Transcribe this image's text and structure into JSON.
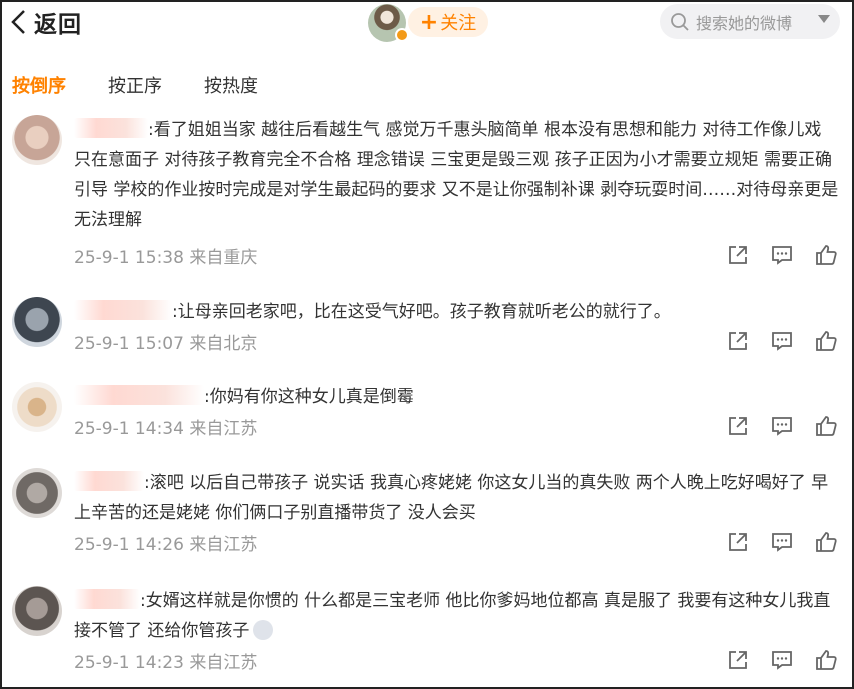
{
  "header": {
    "back_label": "返回",
    "follow_label": "关注",
    "search_placeholder": "搜索她的微博"
  },
  "tabs": [
    {
      "label": "按倒序",
      "active": true
    },
    {
      "label": "按正序",
      "active": false
    },
    {
      "label": "按热度",
      "active": false
    }
  ],
  "comments": [
    {
      "text": ":看了姐姐当家 越往后看越生气 感觉万千惠头脑简单 根本没有思想和能力 对待工作像儿戏 只在意面子  对待孩子教育完全不合格 理念错误 三宝更是毁三观 孩子正因为小才需要立规矩 需要正确引导  学校的作业按时完成是对学生最起码的要求 又不是让你强制补课 剥夺玩耍时间……对待母亲更是 无法理解",
      "time": "25-9-1 15:38",
      "location": "来自重庆"
    },
    {
      "text": ":让母亲回老家吧，比在这受气好吧。孩子教育就听老公的就行了。",
      "time": "25-9-1 15:07",
      "location": "来自北京"
    },
    {
      "text": ":你妈有你这种女儿真是倒霉",
      "time": "25-9-1 14:34",
      "location": "来自江苏"
    },
    {
      "text": ":滚吧 以后自己带孩子 说实话 我真心疼姥姥 你这女儿当的真失败 两个人晚上吃好喝好了 早上辛苦的还是姥姥 你们俩口子别直播带货了 没人会买",
      "time": "25-9-1 14:26",
      "location": "来自江苏"
    },
    {
      "text": ":女婿这样就是你惯的 什么都是三宝老师 他比你爹妈地位都高 真是服了 我要有这种女儿我直接不管了 还给你管孩子",
      "time": "25-9-1 14:23",
      "location": "来自江苏"
    }
  ],
  "colors": {
    "accent": "#ff8200",
    "meta": "#999999",
    "text": "#333333"
  },
  "icons": [
    "back-chevron-icon",
    "plus-icon",
    "search-icon",
    "dropdown-caret-icon",
    "share-icon",
    "comment-icon",
    "like-icon"
  ]
}
